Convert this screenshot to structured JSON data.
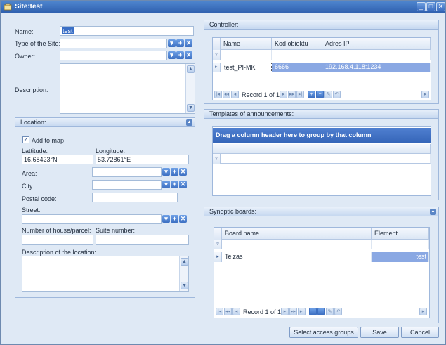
{
  "window": {
    "title": "Site:test"
  },
  "form": {
    "name_label": "Name:",
    "name_value": "test",
    "type_label": "Type of the Site:",
    "type_value": "",
    "owner_label": "Owner:",
    "owner_value": "",
    "description_label": "Description:",
    "description_value": ""
  },
  "location": {
    "header": "Location:",
    "add_to_map_label": "Add to map",
    "add_to_map_checked": true,
    "latitude_label": "Lattitude:",
    "latitude_value": "16.68423°N",
    "longitude_label": "Longitude:",
    "longitude_value": "53.72861°E",
    "area_label": "Area:",
    "city_label": "City:",
    "postal_label": "Postal code:",
    "street_label": "Street:",
    "house_label": "Number of house/parcel:",
    "suite_label": "Suite number:",
    "desc_label": "Description of the location:"
  },
  "controller": {
    "header": "Controller:",
    "columns": [
      "Name",
      "Kod obiektu",
      "Adres IP"
    ],
    "rows": [
      {
        "name": "test_PI-MK",
        "kod": "6666",
        "ip": "192.168.4.118:1234"
      }
    ],
    "record_text": "Record 1 of 1"
  },
  "templates": {
    "header": "Templates of announcements:",
    "group_hint": "Drag a column header here to group by that column"
  },
  "synoptic": {
    "header": "Synoptic boards:",
    "columns": [
      "Board name",
      "Element"
    ],
    "rows": [
      {
        "board": "Telzas",
        "element": "test"
      }
    ],
    "record_text": "Record 1 of 1"
  },
  "buttons": {
    "select_access": "Select access groups",
    "save": "Save",
    "cancel": "Cancel"
  },
  "icons": {
    "dropdown": "▾",
    "add": "+",
    "clear": "✕",
    "filter": "▿",
    "row_pointer": "▸",
    "up": "▲",
    "down": "▼",
    "collapse": "▲"
  }
}
